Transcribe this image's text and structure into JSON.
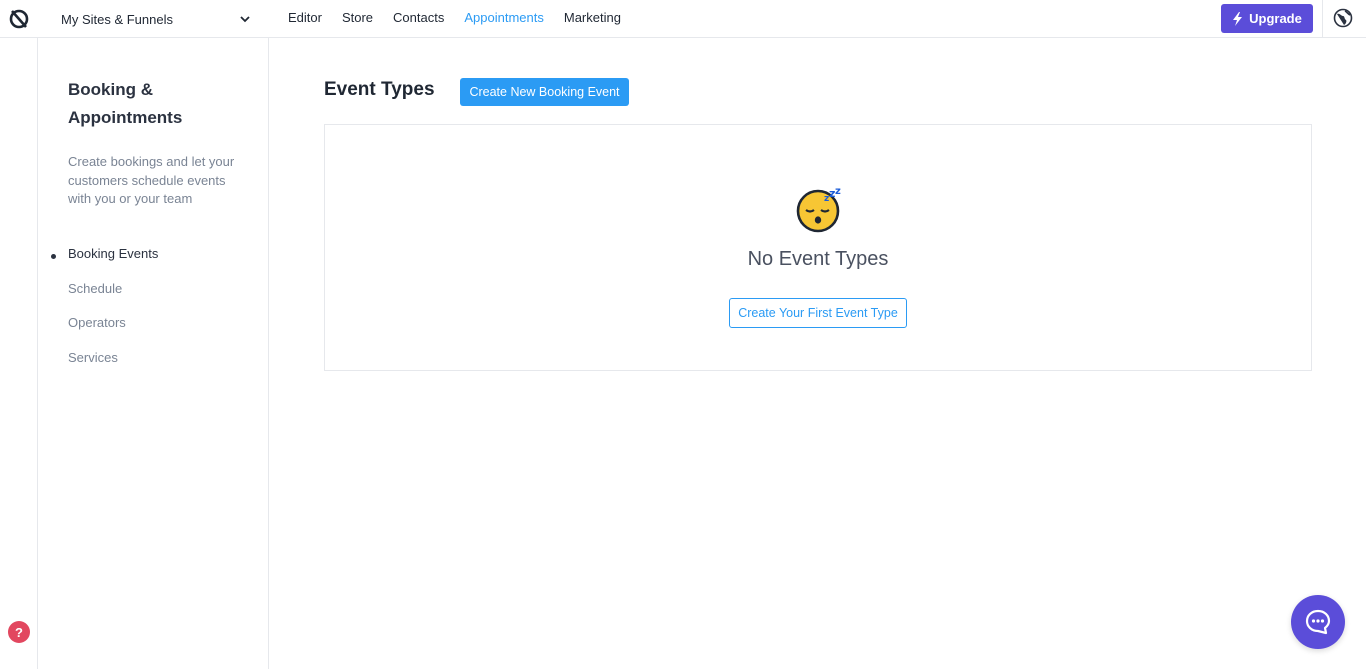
{
  "topbar": {
    "site_selector": "My Sites & Funnels",
    "nav": [
      {
        "label": "Editor",
        "active": false
      },
      {
        "label": "Store",
        "active": false
      },
      {
        "label": "Contacts",
        "active": false
      },
      {
        "label": "Appointments",
        "active": true
      },
      {
        "label": "Marketing",
        "active": false
      }
    ],
    "upgrade_label": "Upgrade",
    "icons": {
      "logo": "brand-logo-icon",
      "chevron": "chevron-down-icon",
      "bolt": "bolt-icon",
      "globe": "globe-icon"
    }
  },
  "sidebar": {
    "title": "Booking & Appointments",
    "description": "Create bookings and let your customers schedule events with you or your team",
    "items": [
      {
        "label": "Booking Events",
        "active": true
      },
      {
        "label": "Schedule",
        "active": false
      },
      {
        "label": "Operators",
        "active": false
      },
      {
        "label": "Services",
        "active": false
      }
    ]
  },
  "main": {
    "title": "Event Types",
    "create_button": "Create New Booking Event",
    "empty_state": {
      "icon": "sleeping-face-icon",
      "title": "No Event Types",
      "button": "Create Your First Event Type"
    }
  },
  "footer": {
    "help_label": "?",
    "chat_icon": "chat-bubble-icon"
  },
  "colors": {
    "accent": "#2b9bf4",
    "upgrade": "#5b4dd9",
    "help": "#e2475f"
  }
}
